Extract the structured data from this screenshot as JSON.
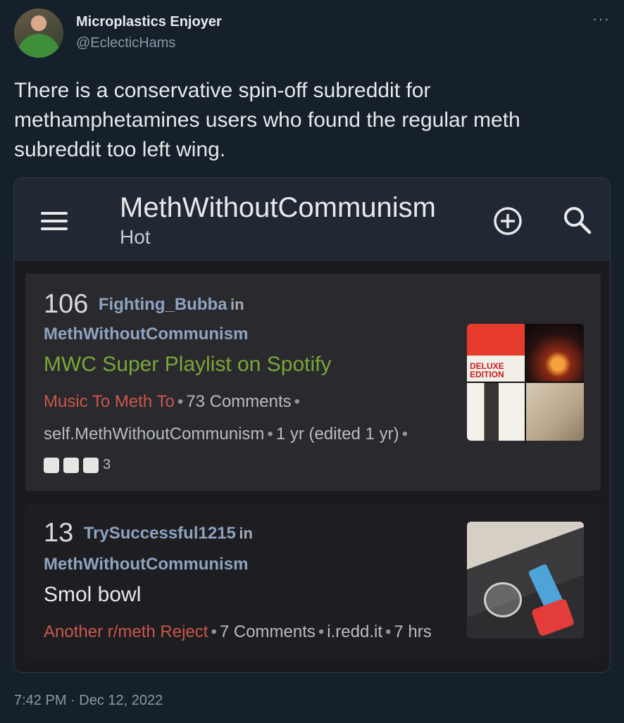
{
  "tweet": {
    "author_name": "Microplastics Enjoyer",
    "author_handle": "@EclecticHams",
    "more_label": "···",
    "text": "There is a conservative spin-off subreddit for methamphetamines users who found the regular meth subreddit too left wing.",
    "timestamp": "7:42 PM · Dec 12, 2022"
  },
  "app": {
    "subreddit_title": "MethWithoutCommunism",
    "sort_label": "Hot",
    "icons": [
      "menu-icon",
      "add-circle-icon",
      "search-icon"
    ]
  },
  "posts": [
    {
      "score": "106",
      "author": "Fighting_Bubba",
      "in_word": "in",
      "subreddit": "MethWithoutCommunism",
      "title": "MWC Super Playlist on Spotify",
      "flair": "Music To Meth To",
      "comments": "73 Comments",
      "domain": "self.MethWithoutCommunism",
      "age": "1 yr (edited 1 yr)",
      "award_count": "3",
      "thumb_text": "DELUXE EDITION"
    },
    {
      "score": "13",
      "author": "TrySuccessful1215",
      "in_word": "in",
      "subreddit": "MethWithoutCommunism",
      "title": "Smol bowl",
      "flair": "Another r/meth Reject",
      "comments": "7 Comments",
      "domain": "i.redd.it",
      "age": "7 hrs"
    }
  ],
  "colors": {
    "background": "#15202b",
    "flair": "#c9574c",
    "title_link": "#79a736",
    "author": "#8da4c0"
  }
}
